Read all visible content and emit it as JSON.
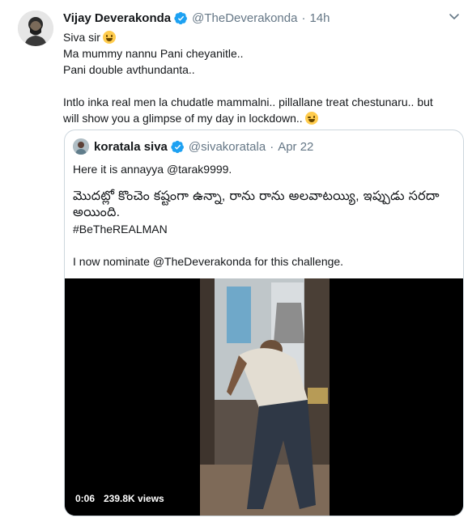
{
  "tweet": {
    "author_name": "Vijay Deverakonda",
    "author_handle": "@TheDeverakonda",
    "time": "14h",
    "line1": "Siva sir",
    "line2": "Ma mummy nannu Pani cheyanitle..",
    "line3": "Pani double avthundanta..",
    "line4a": "Intlo inka real men la chudatle mammalni.. pillallane treat chestunaru.. but",
    "line4b": "will show you a glimpse of my day in lockdown.."
  },
  "quoted": {
    "author_name": "koratala siva",
    "author_handle": "@sivakoratala",
    "date": "Apr 22",
    "line1": "Here it is annayya @tarak9999.",
    "telugu1": "మొదట్లో కొంచెం కష్టంగా ఉన్నా, రాను రాను  అలవాటయ్యి, ఇప్పుడు సరదా",
    "telugu2": "అయింది.",
    "hashtag": "#BeTheREALMAN",
    "line3": "I now nominate @TheDeverakonda for this challenge."
  },
  "video": {
    "elapsed": "0:06",
    "views": "239.8K views"
  },
  "colors": {
    "verified_blue": "#1da1f2",
    "muted": "#657786",
    "border": "#ccd6dd"
  },
  "icons": [
    "verified-badge-icon",
    "chevron-down-icon",
    "grinning-face-emoji",
    "winking-face-emoji"
  ]
}
